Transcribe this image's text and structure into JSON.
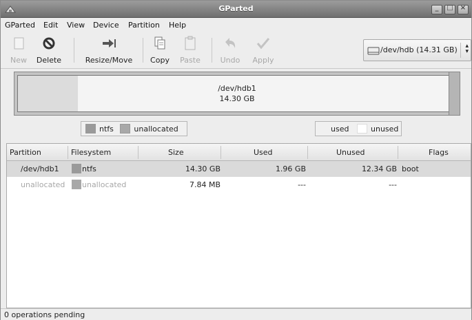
{
  "window": {
    "title": "GParted"
  },
  "menubar": {
    "items": [
      "GParted",
      "Edit",
      "View",
      "Device",
      "Partition",
      "Help"
    ]
  },
  "toolbar": {
    "new": "New",
    "delete": "Delete",
    "resize_move": "Resize/Move",
    "copy": "Copy",
    "paste": "Paste",
    "undo": "Undo",
    "apply": "Apply"
  },
  "device": {
    "selected": "/dev/hdb  (14.31 GB)",
    "icon": "disk-drive-icon"
  },
  "map": {
    "partition_name": "/dev/hdb1",
    "partition_size": "14.30 GB",
    "used_fraction": 0.137
  },
  "legend": {
    "fs_items": [
      "ntfs",
      "unallocated"
    ],
    "usage_items": [
      "used",
      "unused"
    ]
  },
  "colors": {
    "ntfs": "#9a9a9a",
    "unallocated": "#a8a8a8",
    "used": "#dcdcdc",
    "unused": "#ffffff"
  },
  "table": {
    "headers": [
      "Partition",
      "Filesystem",
      "Size",
      "Used",
      "Unused",
      "Flags"
    ],
    "rows": [
      {
        "partition": "/dev/hdb1",
        "filesystem": "ntfs",
        "size": "14.30 GB",
        "used": "1.96 GB",
        "unused": "12.34 GB",
        "flags": "boot"
      },
      {
        "partition": "unallocated",
        "filesystem": "unallocated",
        "size": "7.84 MB",
        "used": "---",
        "unused": "---",
        "flags": ""
      }
    ]
  },
  "status": {
    "text": "0 operations pending"
  }
}
